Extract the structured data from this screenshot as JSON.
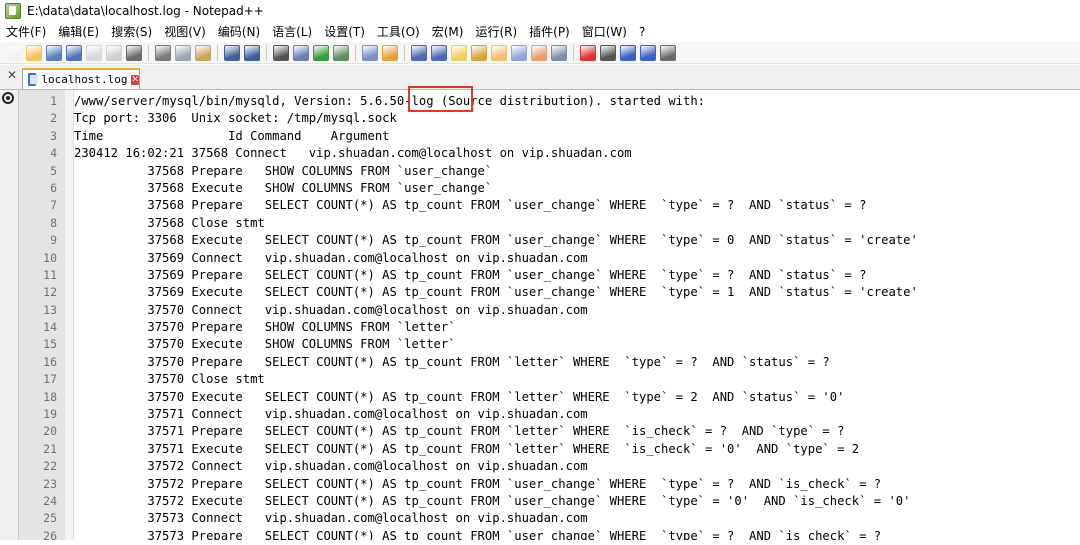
{
  "window": {
    "title": "E:\\data\\data\\localhost.log - Notepad++"
  },
  "menu": [
    "文件(F)",
    "编辑(E)",
    "搜索(S)",
    "视图(V)",
    "编码(N)",
    "语言(L)",
    "设置(T)",
    "工具(O)",
    "宏(M)",
    "运行(R)",
    "插件(P)",
    "窗口(W)",
    "?"
  ],
  "toolbar_icons": [
    "new-file-icon",
    "open-file-icon",
    "save-icon",
    "save-all-icon",
    "close-icon",
    "close-all-icon",
    "print-icon",
    "cut-icon",
    "copy-icon",
    "paste-icon",
    "undo-icon",
    "redo-icon",
    "find-icon",
    "replace-icon",
    "zoom-in-icon",
    "zoom-out-icon",
    "sync-vertical-icon",
    "sync-horizontal-icon",
    "word-wrap-icon",
    "show-all-chars-icon",
    "indent-guide-icon",
    "user-lang-icon",
    "doc-map-icon",
    "function-list-icon",
    "folder-workspace-icon",
    "monitor-icon",
    "record-macro-icon",
    "stop-macro-icon",
    "play-macro-icon",
    "run-macro-multiple-icon",
    "save-macro-icon"
  ],
  "tab": {
    "label": "localhost.log"
  },
  "editor": {
    "lines": [
      "/www/server/mysql/bin/mysqld, Version: 5.6.50-log (Source distribution). started with:",
      "Tcp port: 3306  Unix socket: /tmp/mysql.sock",
      "Time                 Id Command    Argument",
      "230412 16:02:21 37568 Connect   vip.shuadan.com@localhost on vip.shuadan.com",
      "          37568 Prepare   SHOW COLUMNS FROM `user_change`",
      "          37568 Execute   SHOW COLUMNS FROM `user_change`",
      "          37568 Prepare   SELECT COUNT(*) AS tp_count FROM `user_change` WHERE  `type` = ?  AND `status` = ?",
      "          37568 Close stmt",
      "          37568 Execute   SELECT COUNT(*) AS tp_count FROM `user_change` WHERE  `type` = 0  AND `status` = 'create'",
      "          37569 Connect   vip.shuadan.com@localhost on vip.shuadan.com",
      "          37569 Prepare   SELECT COUNT(*) AS tp_count FROM `user_change` WHERE  `type` = ?  AND `status` = ?",
      "          37569 Execute   SELECT COUNT(*) AS tp_count FROM `user_change` WHERE  `type` = 1  AND `status` = 'create'",
      "          37570 Connect   vip.shuadan.com@localhost on vip.shuadan.com",
      "          37570 Prepare   SHOW COLUMNS FROM `letter`",
      "          37570 Execute   SHOW COLUMNS FROM `letter`",
      "          37570 Prepare   SELECT COUNT(*) AS tp_count FROM `letter` WHERE  `type` = ?  AND `status` = ?",
      "          37570 Close stmt",
      "          37570 Execute   SELECT COUNT(*) AS tp_count FROM `letter` WHERE  `type` = 2  AND `status` = '0'",
      "          37571 Connect   vip.shuadan.com@localhost on vip.shuadan.com",
      "          37571 Prepare   SELECT COUNT(*) AS tp_count FROM `letter` WHERE  `is_check` = ?  AND `type` = ?",
      "          37571 Execute   SELECT COUNT(*) AS tp_count FROM `letter` WHERE  `is_check` = '0'  AND `type` = 2",
      "          37572 Connect   vip.shuadan.com@localhost on vip.shuadan.com",
      "          37572 Prepare   SELECT COUNT(*) AS tp_count FROM `user_change` WHERE  `type` = ?  AND `is_check` = ?",
      "          37572 Execute   SELECT COUNT(*) AS tp_count FROM `user_change` WHERE  `type` = '0'  AND `is_check` = '0'",
      "          37573 Connect   vip.shuadan.com@localhost on vip.shuadan.com",
      "          37573 Prepare   SELECT COUNT(*) AS tp_count FROM `user_change` WHERE  `type` = ?  AND `is_check` = ?"
    ]
  },
  "colors": {
    "highlight_box": "#e0392b",
    "tab_accent": "#f7a93a",
    "gutter": "#e4e4e4"
  }
}
